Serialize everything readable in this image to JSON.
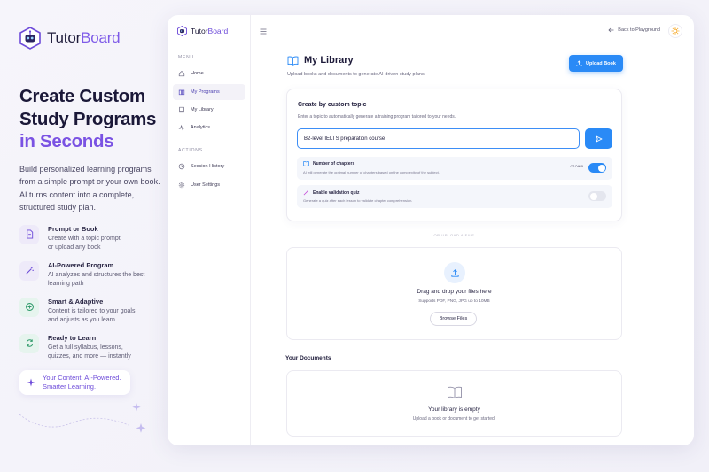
{
  "brand": {
    "name_primary": "Tutor",
    "name_accent": "Board"
  },
  "hero": {
    "line1": "Create Custom",
    "line2": "Study Programs",
    "line3": "in Seconds"
  },
  "intro": "Build personalized learning programs from a simple prompt or your own book. AI turns content into a complete, structured study plan.",
  "features": [
    {
      "title": "Prompt or Book",
      "desc": "Create with a topic prompt\nor upload any book",
      "icon": "document-icon",
      "color": "#6d4bd9",
      "bg": "#eeeaf9"
    },
    {
      "title": "AI-Powered Program",
      "desc": "AI analyzes and structures the best\nlearning path",
      "icon": "magic-wand-icon",
      "color": "#6d4bd9",
      "bg": "#eeeaf9"
    },
    {
      "title": "Smart & Adaptive",
      "desc": "Content is tailored to your goals\nand adjusts as you learn",
      "icon": "adaptive-icon",
      "color": "#2f9a6a",
      "bg": "#e6f4ee"
    },
    {
      "title": "Ready to Learn",
      "desc": "Get a full syllabus, lessons,\nquizzes, and more — instantly",
      "icon": "refresh-icon",
      "color": "#2f9a6a",
      "bg": "#e6f4ee"
    }
  ],
  "tagline": "Your Content. AI-Powered.\nSmarter Learning.",
  "app": {
    "brand": {
      "name_primary": "Tutor",
      "name_accent": "Board"
    },
    "sidebar": {
      "menu_label": "MENU",
      "items": [
        {
          "label": "Home",
          "icon": "home-icon"
        },
        {
          "label": "My Programs",
          "icon": "programs-icon",
          "active": true
        },
        {
          "label": "My Library",
          "icon": "library-icon"
        },
        {
          "label": "Analytics",
          "icon": "analytics-icon"
        }
      ],
      "actions_label": "ACTIONS",
      "action_items": [
        {
          "label": "Session History",
          "icon": "history-icon"
        },
        {
          "label": "User Settings",
          "icon": "settings-icon"
        }
      ]
    },
    "topbar": {
      "back_label": "Back to Playground"
    },
    "page": {
      "title": "My Library",
      "subtitle": "Upload books and documents to generate AI-driven study plans.",
      "upload_button": "Upload Book"
    },
    "create": {
      "title": "Create by custom topic",
      "desc": "Enter a topic to automatically generate a training program tailored to your needs.",
      "input_value": "B2-level IELTS preparation course",
      "options": [
        {
          "title": "Number of chapters",
          "desc": "AI will generate the optimal number of chapters based on the complexity of the subject.",
          "right_label": "AI Auto",
          "enabled": true
        },
        {
          "title": "Enable validation quiz",
          "desc": "Generate a quiz after each lesson to validate chapter comprehension.",
          "right_label": "",
          "enabled": false
        }
      ]
    },
    "divider_text": "OR UPLOAD A FILE",
    "dropzone": {
      "title": "Drag and drop your files here",
      "subtitle": "Supports PDF, PNG, JPG up to 10MB",
      "browse_label": "Browse Files"
    },
    "documents": {
      "title": "Your Documents",
      "empty_title": "Your library is empty",
      "empty_sub": "Upload a book or document to get started."
    }
  }
}
